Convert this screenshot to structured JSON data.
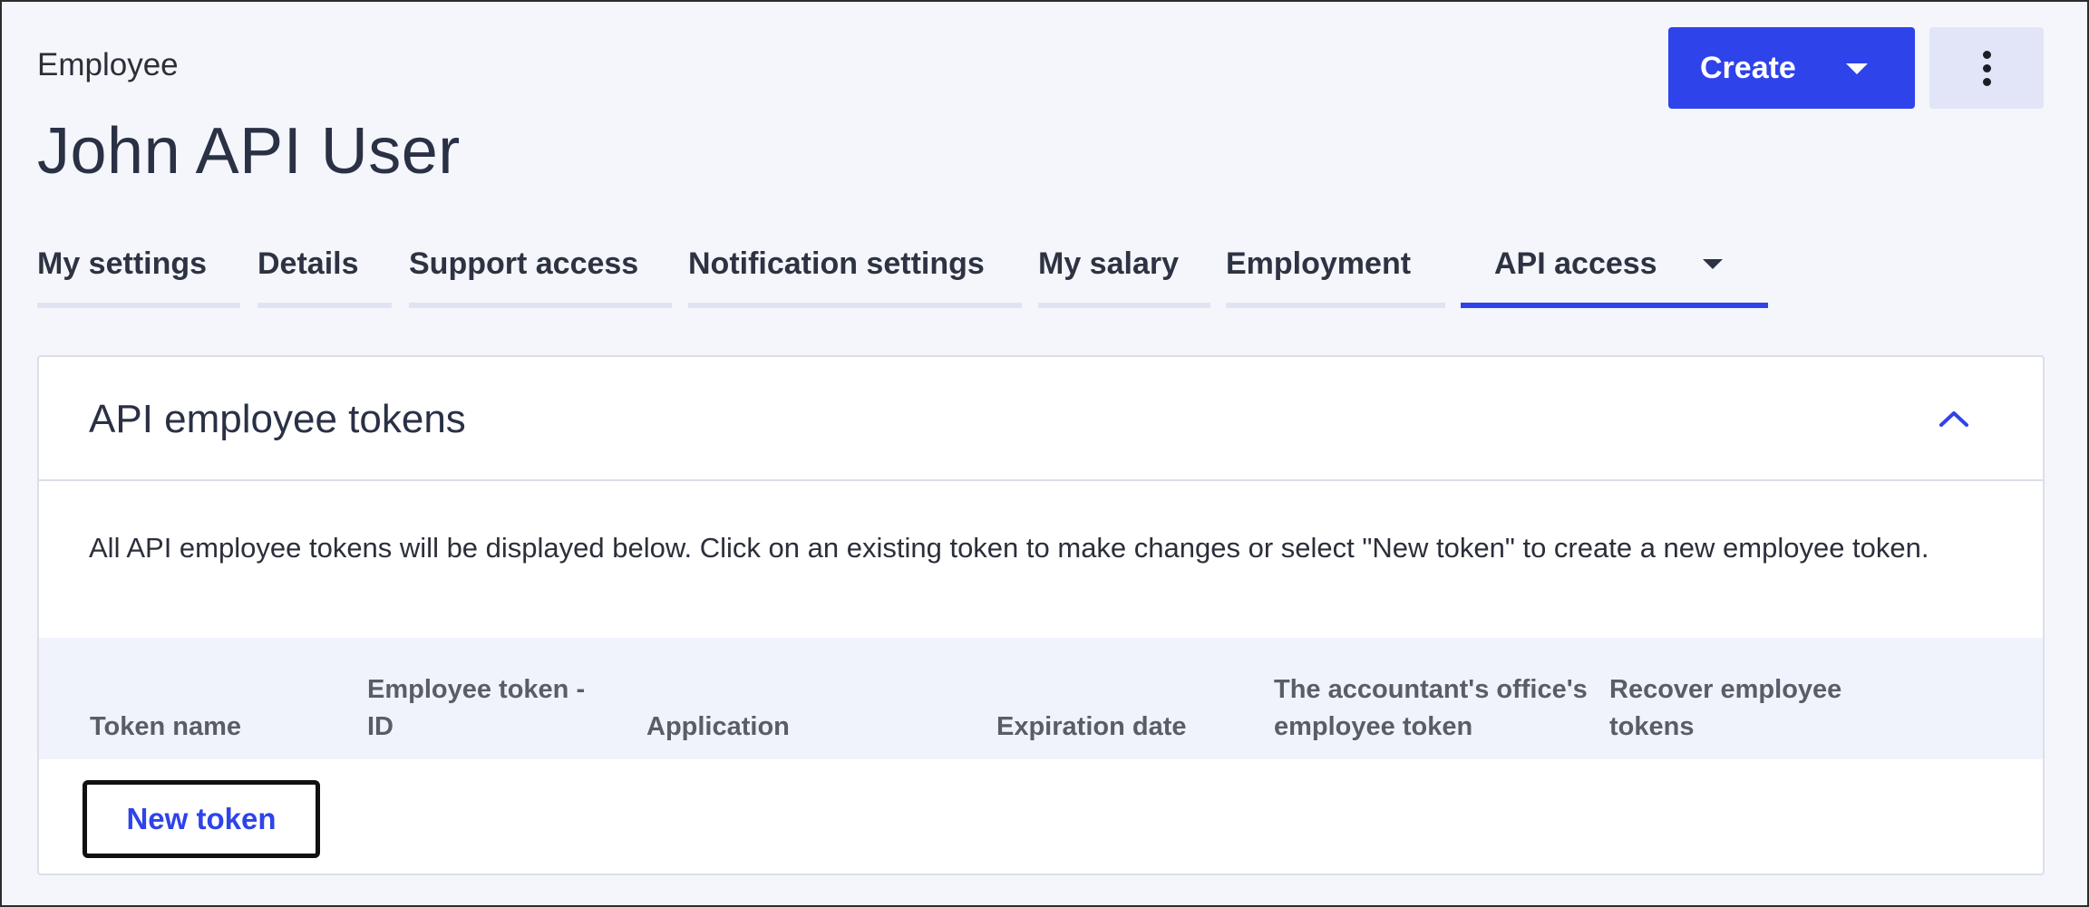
{
  "header": {
    "breadcrumb": "Employee",
    "title": "John API User",
    "create_label": "Create",
    "more_icon": "vertical-ellipsis-icon"
  },
  "tabs": [
    {
      "label": "My settings",
      "active": false
    },
    {
      "label": "Details",
      "active": false
    },
    {
      "label": "Support access",
      "active": false
    },
    {
      "label": "Notification settings",
      "active": false
    },
    {
      "label": "My salary",
      "active": false
    },
    {
      "label": "Employment",
      "active": false
    },
    {
      "label": "API access",
      "active": true
    }
  ],
  "panel": {
    "title": "API employee tokens",
    "collapse_icon": "chevron-up-icon",
    "description": "All API employee tokens will be displayed below. Click on an existing token to make changes or select \"New token\" to create a new employee token.",
    "columns": [
      "Token name",
      "Employee token - ID",
      "Application",
      "Expiration date",
      "The accountant's office's employee token",
      "Recover employee tokens"
    ],
    "new_token_label": "New token"
  },
  "colors": {
    "accent": "#2f43ea",
    "background": "#f4f6fb",
    "table_header": "#f0f3fc"
  }
}
